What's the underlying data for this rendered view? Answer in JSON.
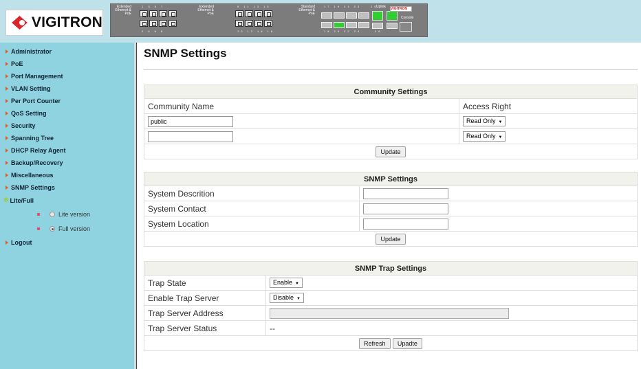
{
  "header": {
    "brand": "VIGITRON",
    "panel": {
      "extended_label_1": "Extended Ethernet & PoE",
      "extended_label_2": "Extended Ethernet & PoE",
      "standard_label": "Standard Ethernet & PoE",
      "uplink_label": "Uplink",
      "console_label": "Console",
      "mini_brand": "VIGITRON",
      "top_nums_1": "1 3 5 7",
      "bottom_nums_1": "2 4 6 8",
      "top_nums_2": "9 11 13 15",
      "bottom_nums_2": "10 12 14 16",
      "top_nums_3": "17 19 21 23",
      "bottom_nums_3": "18 20 22 24",
      "num_25": "25",
      "num_26": "26"
    }
  },
  "sidebar": {
    "items": [
      {
        "label": "Administrator"
      },
      {
        "label": "PoE"
      },
      {
        "label": "Port Management"
      },
      {
        "label": "VLAN Setting"
      },
      {
        "label": "Per Port Counter"
      },
      {
        "label": "QoS Setting"
      },
      {
        "label": "Security"
      },
      {
        "label": "Spanning Tree"
      },
      {
        "label": "DHCP Relay Agent"
      },
      {
        "label": "Backup/Recovery"
      },
      {
        "label": "Miscellaneous"
      },
      {
        "label": "SNMP Settings"
      },
      {
        "label": "Lite/Full"
      }
    ],
    "lite_option": "Lite version",
    "full_option": "Full version",
    "selected_version": "Full version",
    "logout": "Logout"
  },
  "main": {
    "title": "SNMP Settings",
    "community": {
      "header": "Community Settings",
      "col_name": "Community Name",
      "col_access": "Access Right",
      "rows": [
        {
          "name": "public",
          "access": "Read Only"
        },
        {
          "name": "",
          "access": "Read Only"
        }
      ],
      "update_label": "Update"
    },
    "snmp": {
      "header": "SNMP Settings",
      "description_label": "System Descrition",
      "description_value": "",
      "contact_label": "System Contact",
      "contact_value": "",
      "location_label": "System Location",
      "location_value": "",
      "update_label": "Update"
    },
    "trap": {
      "header": "SNMP Trap Settings",
      "state_label": "Trap State",
      "state_value": "Enable",
      "enable_server_label": "Enable Trap Server",
      "enable_server_value": "Disable",
      "address_label": "Trap Server Address",
      "address_value": "",
      "status_label": "Trap Server Status",
      "status_value": "--",
      "refresh_label": "Refresh",
      "update_label": "Upadte"
    }
  },
  "colors": {
    "header_bg": "#bfe1ea",
    "sidebar_bg": "#8fd3e0",
    "brand_red": "#d9262c",
    "port_active": "#33cc33"
  }
}
